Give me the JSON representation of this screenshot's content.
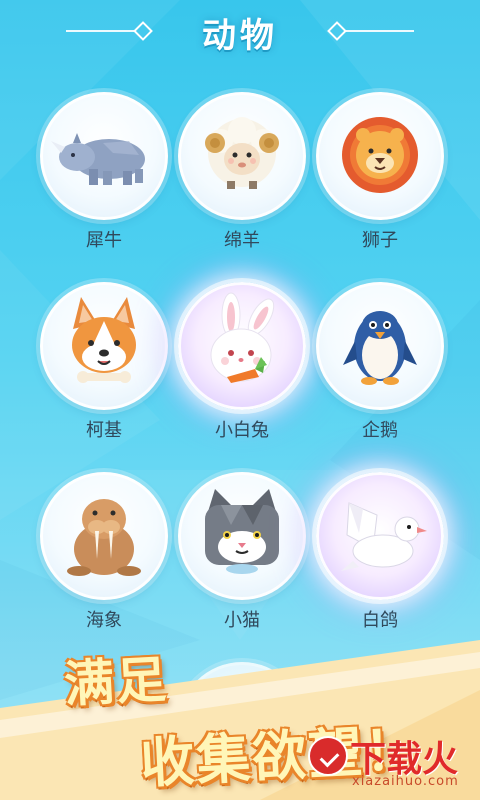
{
  "header": {
    "title": "动物"
  },
  "animals": [
    {
      "name": "犀牛",
      "icon": "rhino-icon",
      "highlighted": false
    },
    {
      "name": "绵羊",
      "icon": "sheep-icon",
      "highlighted": false
    },
    {
      "name": "狮子",
      "icon": "lion-icon",
      "highlighted": false
    },
    {
      "name": "柯基",
      "icon": "corgi-icon",
      "highlighted": false
    },
    {
      "name": "小白兔",
      "icon": "rabbit-icon",
      "highlighted": true
    },
    {
      "name": "企鹅",
      "icon": "penguin-icon",
      "highlighted": false
    },
    {
      "name": "海象",
      "icon": "walrus-icon",
      "highlighted": false
    },
    {
      "name": "小猫",
      "icon": "cat-icon",
      "highlighted": false
    },
    {
      "name": "白鸽",
      "icon": "dove-icon",
      "highlighted": true
    }
  ],
  "banner": {
    "line1": "满足",
    "line2": "收集欲望！"
  },
  "watermark": {
    "name": "下载火",
    "url": "xiazaihuo.com"
  },
  "colors": {
    "sky": "#38c6ec",
    "slogan_fill": "#fff6b8",
    "slogan_outline": "#e9852a",
    "watermark_red": "#e02a2a"
  }
}
